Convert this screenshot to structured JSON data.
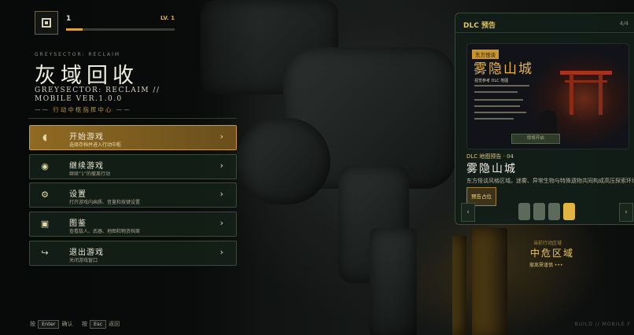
{
  "player": {
    "level_value": "1",
    "level_tag": "LV. 1",
    "xp_progress": 0.15
  },
  "title": {
    "en_small": "GREYSECTOR: RECLAIM",
    "cn": "灰域回收",
    "en_main": "GREYSECTOR: RECLAIM // MOBILE VER.1.0.0",
    "subline": "—— 行动中枢指挥中心 ——"
  },
  "menu": [
    {
      "title": "开始游戏",
      "desc": "选择存档并进入行动中枢",
      "icon": "half-circle-icon"
    },
    {
      "title": "继续游戏",
      "desc": "继续“1”的撤离行动",
      "icon": "target-icon"
    },
    {
      "title": "设置",
      "desc": "打开游戏内画质、音量和按键设置",
      "icon": "gear-icon"
    },
    {
      "title": "图鉴",
      "desc": "查看敌人、武器、地图和物资档案",
      "icon": "square-icon"
    },
    {
      "title": "退出游戏",
      "desc": "关闭游戏窗口",
      "icon": "exit-arrow-icon"
    }
  ],
  "menu_arrow": "›",
  "hints": {
    "enter_prefix": "按",
    "enter_key": "Enter",
    "enter_action": "确认",
    "esc_prefix": "按",
    "esc_key": "Esc",
    "esc_action": "返回",
    "build": "BUILD // MOBILE F"
  },
  "dlc": {
    "header": "DLC 预告",
    "page": "4/4",
    "image": {
      "badge": "东方怪谈",
      "title": "雾隐山城",
      "subtitle": "视觉参考 DLC 地图",
      "button": "即将开启"
    },
    "kicker": "DLC 地图预告 · 04",
    "name": "雾隐山城",
    "description": "东方怪谈风格区域。迷雾、异常生物与特殊遗物共同构成高压探索环境。",
    "tag": "预告占位",
    "prev": "‹",
    "next": "›",
    "slide_count": 4,
    "active_slide": 4
  },
  "area": {
    "kicker": "当前行动区域",
    "name": "中危区域",
    "status": "撤离需谨慎 •••"
  },
  "colors": {
    "accent": "#d9a53a",
    "panel": "#12201a",
    "text": "#f0ece0"
  }
}
